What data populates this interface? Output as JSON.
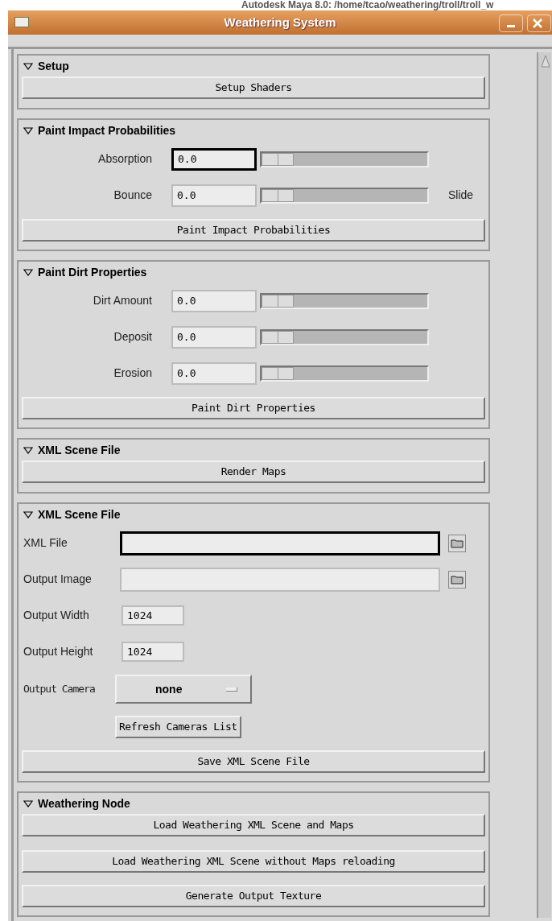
{
  "background_window": {
    "title": "Autodesk Maya 8.0: /home/tcao/weathering/troll/troll_w"
  },
  "window": {
    "title": "Weathering System"
  },
  "sections": [
    {
      "title": "Setup",
      "expanded": true,
      "items": [
        {
          "kind": "button",
          "label": "Setup Shaders"
        }
      ]
    },
    {
      "title": "Paint Impact Probabilities",
      "expanded": true,
      "items": [
        {
          "kind": "slider",
          "label": "Absorption",
          "value": "0.0",
          "focused": true,
          "level": 0
        },
        {
          "kind": "slider",
          "label": "Bounce",
          "value": "0.0",
          "focused": false,
          "level": 0,
          "suffix": "Slide"
        },
        {
          "kind": "button",
          "label": "Paint Impact Probabilities"
        }
      ]
    },
    {
      "title": "Paint Dirt Properties",
      "expanded": true,
      "items": [
        {
          "kind": "slider",
          "label": "Dirt Amount",
          "value": "0.0",
          "focused": false,
          "level": 0
        },
        {
          "kind": "slider",
          "label": "Deposit",
          "value": "0.0",
          "focused": false,
          "level": 0
        },
        {
          "kind": "slider",
          "label": "Erosion",
          "value": "0.0",
          "focused": false,
          "level": 0
        },
        {
          "kind": "button",
          "label": "Paint Dirt Properties"
        }
      ]
    },
    {
      "title": "XML Scene File",
      "expanded": true,
      "items": [
        {
          "kind": "button",
          "label": "Render Maps"
        }
      ]
    },
    {
      "title": "XML Scene File",
      "expanded": true,
      "items": [
        {
          "kind": "path",
          "label": "XML File",
          "focused": true
        },
        {
          "kind": "path",
          "label": "Output Image",
          "focused": false
        },
        {
          "kind": "int",
          "label": "Output Width",
          "value": "1024"
        },
        {
          "kind": "int",
          "label": "Output Height",
          "value": "1024"
        },
        {
          "kind": "option",
          "label": "Output Camera",
          "value": "none"
        },
        {
          "kind": "small_button",
          "label": "Refresh Cameras List"
        },
        {
          "kind": "button",
          "label": "Save XML Scene File"
        }
      ]
    },
    {
      "title": "Weathering Node",
      "expanded": true,
      "items": [
        {
          "kind": "button",
          "label": "Load Weathering XML Scene and Maps"
        },
        {
          "kind": "button",
          "label": "Load Weathering XML Scene without Maps reloading"
        },
        {
          "kind": "button",
          "label": "Generate Output Texture"
        }
      ]
    }
  ]
}
